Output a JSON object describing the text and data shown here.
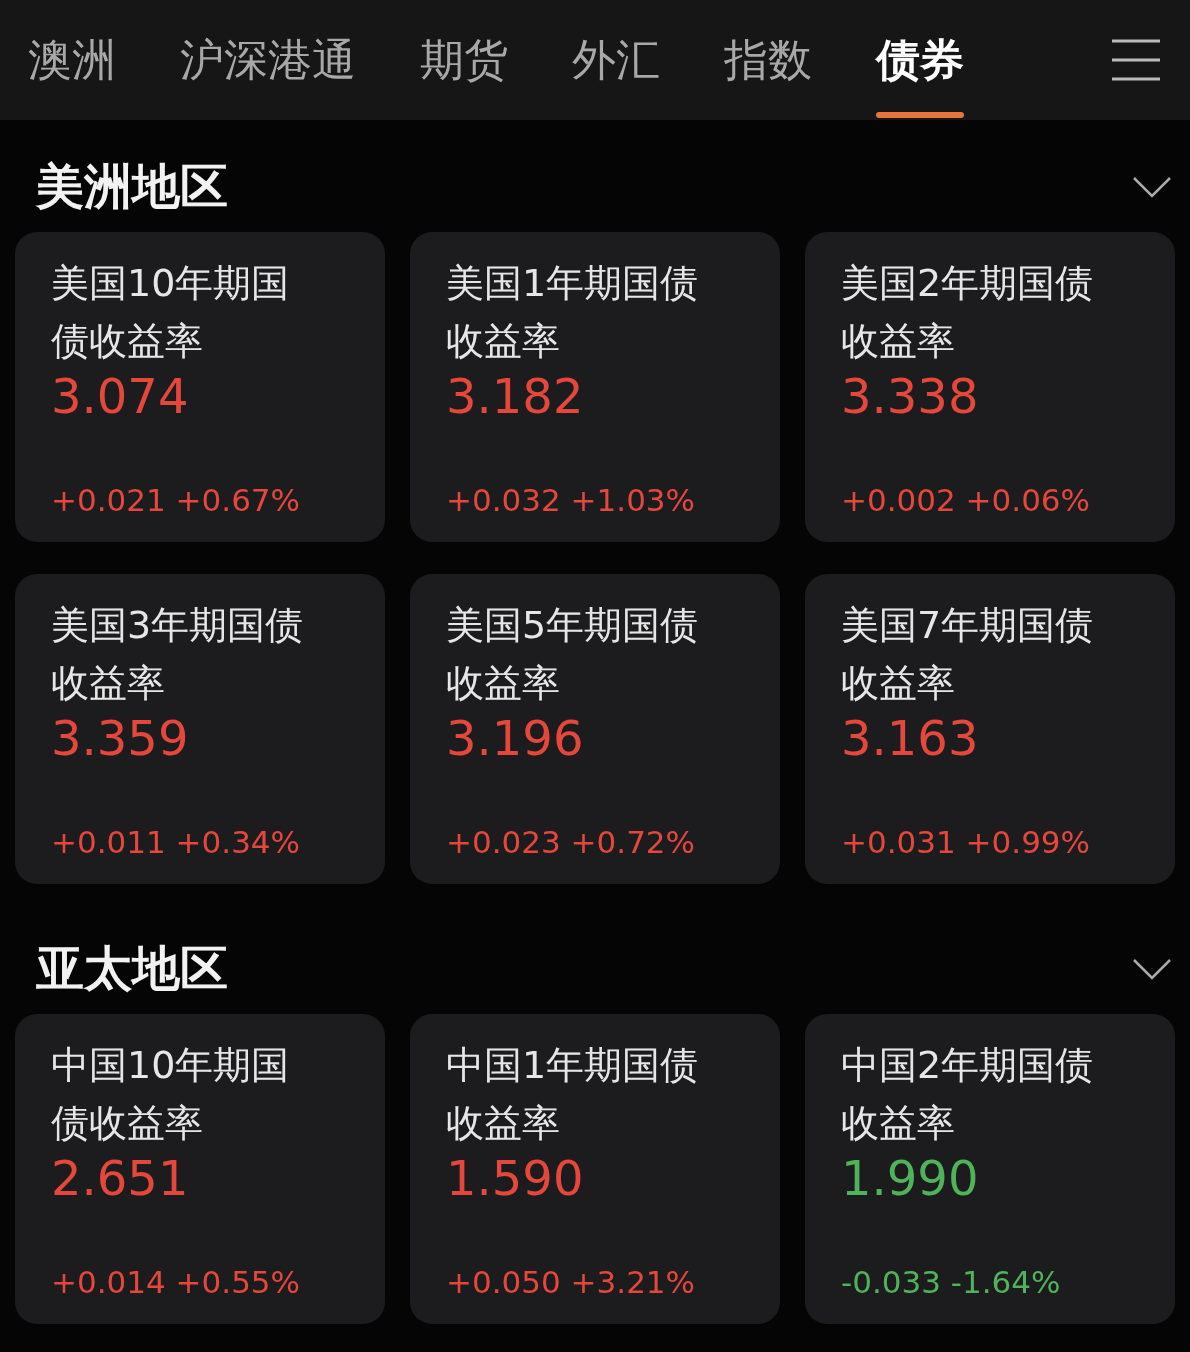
{
  "tabs": [
    {
      "label": "澳洲",
      "selected": false
    },
    {
      "label": "沪深港通",
      "selected": false
    },
    {
      "label": "期货",
      "selected": false
    },
    {
      "label": "外汇",
      "selected": false
    },
    {
      "label": "指数",
      "selected": false
    },
    {
      "label": "债券",
      "selected": true
    }
  ],
  "sections": [
    {
      "title": "美洲地区",
      "expanded": true,
      "cards": [
        {
          "name": "美国10年期国债收益率",
          "value": "3.074",
          "change": "+0.021",
          "percent": "+0.67%",
          "color": "#e5473b"
        },
        {
          "name": "美国1年期国债收益率",
          "value": "3.182",
          "change": "+0.032",
          "percent": "+1.03%",
          "color": "#e5473b"
        },
        {
          "name": "美国2年期国债收益率",
          "value": "3.338",
          "change": "+0.002",
          "percent": "+0.06%",
          "color": "#e5473b"
        },
        {
          "name": "美国3年期国债收益率",
          "value": "3.359",
          "change": "+0.011",
          "percent": "+0.34%",
          "color": "#e5473b"
        },
        {
          "name": "美国5年期国债收益率",
          "value": "3.196",
          "change": "+0.023",
          "percent": "+0.72%",
          "color": "#e5473b"
        },
        {
          "name": "美国7年期国债收益率",
          "value": "3.163",
          "change": "+0.031",
          "percent": "+0.99%",
          "color": "#e5473b"
        }
      ]
    },
    {
      "title": "亚太地区",
      "expanded": true,
      "cards": [
        {
          "name": "中国10年期国债收益率",
          "value": "2.651",
          "change": "+0.014",
          "percent": "+0.55%",
          "color": "#e5473b"
        },
        {
          "name": "中国1年期国债收益率",
          "value": "1.590",
          "change": "+0.050",
          "percent": "+3.21%",
          "color": "#e5473b"
        },
        {
          "name": "中国2年期国债收益率",
          "value": "1.990",
          "change": "-0.033",
          "percent": "-1.64%",
          "color": "#4fb35a"
        }
      ]
    }
  ]
}
